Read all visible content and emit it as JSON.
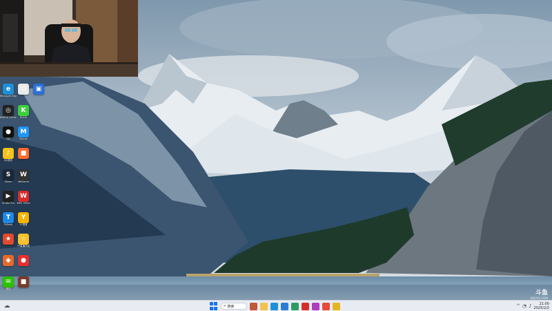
{
  "desktop": {
    "icons": [
      {
        "id": "edge",
        "label": "Microsoft Edge",
        "color": "#1f8fd8",
        "glyph": "e",
        "icon": "edge-icon"
      },
      {
        "id": "user",
        "label": "",
        "color": "#e9e9e9",
        "glyph": "☺",
        "icon": "user-icon"
      },
      {
        "id": "remote",
        "label": "",
        "color": "#2d6fd6",
        "glyph": "▣",
        "icon": "remote-desktop-icon"
      },
      {
        "id": "nvidia",
        "label": "NVIDIA GeForce",
        "color": "#222",
        "glyph": "◎",
        "icon": "nvidia-icon"
      },
      {
        "id": "kook",
        "label": "KOOK",
        "color": "#3ecf3e",
        "glyph": "K",
        "icon": "kook-icon"
      },
      {
        "id": "qq",
        "label": "QQ",
        "color": "#111",
        "glyph": "●",
        "icon": "qq-penguin-icon"
      },
      {
        "id": "mobile",
        "label": "Mobile",
        "color": "#2196f3",
        "glyph": "M",
        "icon": "mobile-app-icon"
      },
      {
        "id": "qqmusic",
        "label": "QQ音乐",
        "color": "#f6c21c",
        "glyph": "♪",
        "icon": "qq-music-icon"
      },
      {
        "id": "app8",
        "label": "",
        "color": "#ff6b2c",
        "glyph": "■",
        "icon": "app-icon"
      },
      {
        "id": "steam",
        "label": "Steam",
        "color": "#1b2838",
        "glyph": "S",
        "icon": "steam-icon"
      },
      {
        "id": "wegame",
        "label": "WeGame",
        "color": "#333",
        "glyph": "W",
        "icon": "wegame-icon"
      },
      {
        "id": "studio",
        "label": "Studio Pro",
        "color": "#222",
        "glyph": "▶",
        "icon": "studio-icon"
      },
      {
        "id": "wps",
        "label": "WPS Office",
        "color": "#d62c2c",
        "glyph": "W",
        "icon": "wps-icon"
      },
      {
        "id": "todesk",
        "label": "ToDesk",
        "color": "#1e88e5",
        "glyph": "T",
        "icon": "todesk-icon"
      },
      {
        "id": "yy",
        "label": "YY语音",
        "color": "#f5b400",
        "glyph": "Y",
        "icon": "yy-icon"
      },
      {
        "id": "app16",
        "label": "",
        "color": "#e04a2f",
        "glyph": "★",
        "icon": "app-icon"
      },
      {
        "id": "app17",
        "label": "YY直播伴侣",
        "color": "#f7c02c",
        "glyph": "☆",
        "icon": "app-icon"
      },
      {
        "id": "app18",
        "label": "",
        "color": "#e46b2c",
        "glyph": "◆",
        "icon": "app-icon"
      },
      {
        "id": "app19",
        "label": "",
        "color": "#e82f2f",
        "glyph": "●",
        "icon": "app-icon"
      },
      {
        "id": "wechat",
        "label": "微信",
        "color": "#2dc100",
        "glyph": "✉",
        "icon": "wechat-icon"
      },
      {
        "id": "app21",
        "label": "",
        "color": "#7a3b2a",
        "glyph": "■",
        "icon": "app-icon"
      }
    ]
  },
  "watermark": {
    "text": "斗鱼",
    "sub": "DOUYU.COM"
  },
  "taskbar": {
    "search_placeholder": "搜索",
    "apps": [
      {
        "icon": "widgets-icon",
        "color": "#c0573a"
      },
      {
        "icon": "file-explorer-icon",
        "color": "#f2c14e"
      },
      {
        "icon": "edge-icon",
        "color": "#1f8fd8"
      },
      {
        "icon": "store-icon",
        "color": "#2b7bd6"
      },
      {
        "icon": "photos-icon",
        "color": "#2e9b63"
      },
      {
        "icon": "wps-icon",
        "color": "#d62c2c"
      },
      {
        "icon": "media-icon",
        "color": "#b03ac0"
      },
      {
        "icon": "chrome-icon",
        "color": "#e84a3a"
      },
      {
        "icon": "app-icon",
        "color": "#e6b422"
      }
    ],
    "clock_time": "21:00",
    "clock_date": "2025/2/2"
  }
}
